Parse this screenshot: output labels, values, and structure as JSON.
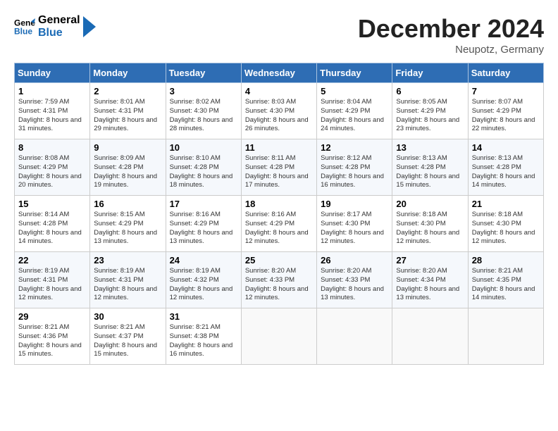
{
  "header": {
    "logo_line1": "General",
    "logo_line2": "Blue",
    "month_title": "December 2024",
    "subtitle": "Neupotz, Germany"
  },
  "days_of_week": [
    "Sunday",
    "Monday",
    "Tuesday",
    "Wednesday",
    "Thursday",
    "Friday",
    "Saturday"
  ],
  "weeks": [
    [
      {
        "day": 1,
        "sunrise": "7:59 AM",
        "sunset": "4:31 PM",
        "daylight": "8 hours and 31 minutes."
      },
      {
        "day": 2,
        "sunrise": "8:01 AM",
        "sunset": "4:31 PM",
        "daylight": "8 hours and 29 minutes."
      },
      {
        "day": 3,
        "sunrise": "8:02 AM",
        "sunset": "4:30 PM",
        "daylight": "8 hours and 28 minutes."
      },
      {
        "day": 4,
        "sunrise": "8:03 AM",
        "sunset": "4:30 PM",
        "daylight": "8 hours and 26 minutes."
      },
      {
        "day": 5,
        "sunrise": "8:04 AM",
        "sunset": "4:29 PM",
        "daylight": "8 hours and 24 minutes."
      },
      {
        "day": 6,
        "sunrise": "8:05 AM",
        "sunset": "4:29 PM",
        "daylight": "8 hours and 23 minutes."
      },
      {
        "day": 7,
        "sunrise": "8:07 AM",
        "sunset": "4:29 PM",
        "daylight": "8 hours and 22 minutes."
      }
    ],
    [
      {
        "day": 8,
        "sunrise": "8:08 AM",
        "sunset": "4:29 PM",
        "daylight": "8 hours and 20 minutes."
      },
      {
        "day": 9,
        "sunrise": "8:09 AM",
        "sunset": "4:28 PM",
        "daylight": "8 hours and 19 minutes."
      },
      {
        "day": 10,
        "sunrise": "8:10 AM",
        "sunset": "4:28 PM",
        "daylight": "8 hours and 18 minutes."
      },
      {
        "day": 11,
        "sunrise": "8:11 AM",
        "sunset": "4:28 PM",
        "daylight": "8 hours and 17 minutes."
      },
      {
        "day": 12,
        "sunrise": "8:12 AM",
        "sunset": "4:28 PM",
        "daylight": "8 hours and 16 minutes."
      },
      {
        "day": 13,
        "sunrise": "8:13 AM",
        "sunset": "4:28 PM",
        "daylight": "8 hours and 15 minutes."
      },
      {
        "day": 14,
        "sunrise": "8:13 AM",
        "sunset": "4:28 PM",
        "daylight": "8 hours and 14 minutes."
      }
    ],
    [
      {
        "day": 15,
        "sunrise": "8:14 AM",
        "sunset": "4:28 PM",
        "daylight": "8 hours and 14 minutes."
      },
      {
        "day": 16,
        "sunrise": "8:15 AM",
        "sunset": "4:29 PM",
        "daylight": "8 hours and 13 minutes."
      },
      {
        "day": 17,
        "sunrise": "8:16 AM",
        "sunset": "4:29 PM",
        "daylight": "8 hours and 13 minutes."
      },
      {
        "day": 18,
        "sunrise": "8:16 AM",
        "sunset": "4:29 PM",
        "daylight": "8 hours and 12 minutes."
      },
      {
        "day": 19,
        "sunrise": "8:17 AM",
        "sunset": "4:30 PM",
        "daylight": "8 hours and 12 minutes."
      },
      {
        "day": 20,
        "sunrise": "8:18 AM",
        "sunset": "4:30 PM",
        "daylight": "8 hours and 12 minutes."
      },
      {
        "day": 21,
        "sunrise": "8:18 AM",
        "sunset": "4:30 PM",
        "daylight": "8 hours and 12 minutes."
      }
    ],
    [
      {
        "day": 22,
        "sunrise": "8:19 AM",
        "sunset": "4:31 PM",
        "daylight": "8 hours and 12 minutes."
      },
      {
        "day": 23,
        "sunrise": "8:19 AM",
        "sunset": "4:31 PM",
        "daylight": "8 hours and 12 minutes."
      },
      {
        "day": 24,
        "sunrise": "8:19 AM",
        "sunset": "4:32 PM",
        "daylight": "8 hours and 12 minutes."
      },
      {
        "day": 25,
        "sunrise": "8:20 AM",
        "sunset": "4:33 PM",
        "daylight": "8 hours and 12 minutes."
      },
      {
        "day": 26,
        "sunrise": "8:20 AM",
        "sunset": "4:33 PM",
        "daylight": "8 hours and 13 minutes."
      },
      {
        "day": 27,
        "sunrise": "8:20 AM",
        "sunset": "4:34 PM",
        "daylight": "8 hours and 13 minutes."
      },
      {
        "day": 28,
        "sunrise": "8:21 AM",
        "sunset": "4:35 PM",
        "daylight": "8 hours and 14 minutes."
      }
    ],
    [
      {
        "day": 29,
        "sunrise": "8:21 AM",
        "sunset": "4:36 PM",
        "daylight": "8 hours and 15 minutes."
      },
      {
        "day": 30,
        "sunrise": "8:21 AM",
        "sunset": "4:37 PM",
        "daylight": "8 hours and 15 minutes."
      },
      {
        "day": 31,
        "sunrise": "8:21 AM",
        "sunset": "4:38 PM",
        "daylight": "8 hours and 16 minutes."
      },
      null,
      null,
      null,
      null
    ]
  ],
  "labels": {
    "sunrise": "Sunrise:",
    "sunset": "Sunset:",
    "daylight": "Daylight:"
  }
}
